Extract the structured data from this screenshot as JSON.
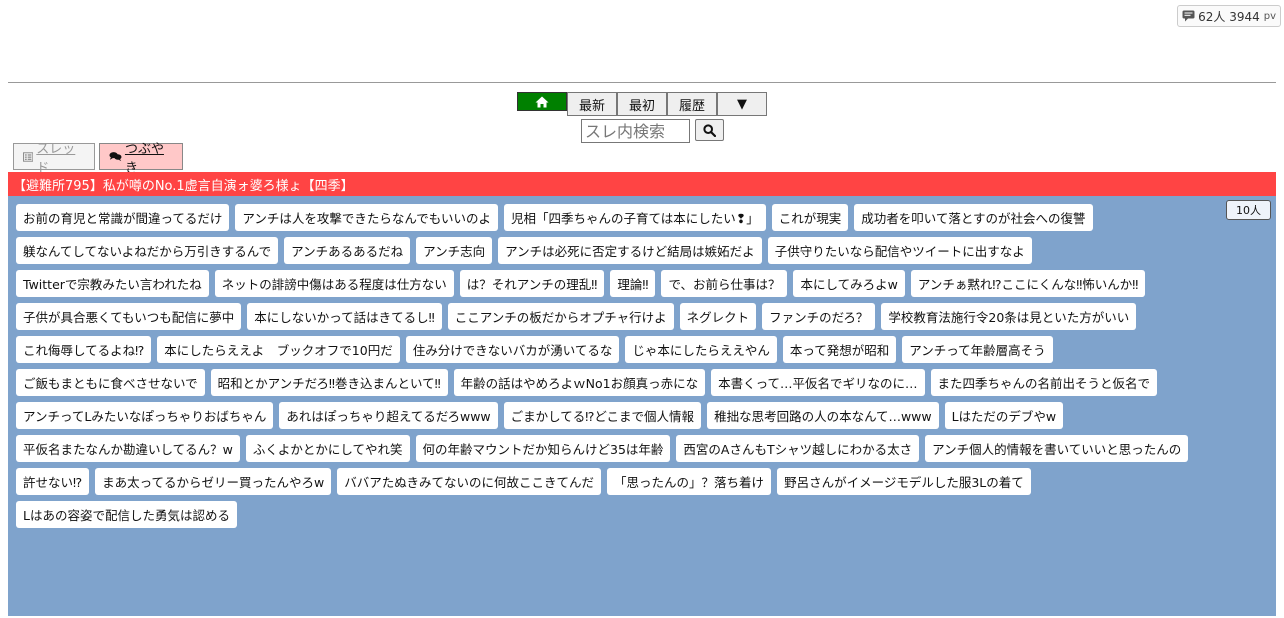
{
  "stats": {
    "text": "62人 3944",
    "pv": "pv"
  },
  "nav": {
    "latest": "最新",
    "first": "最初",
    "history": "履歴",
    "more": "▼"
  },
  "search": {
    "placeholder": "スレ内検索"
  },
  "tabs": {
    "thread": "スレッド",
    "tweet": "つぶやき"
  },
  "title": "【避難所795】私が噂のNo.1虚言自演ォ婆ろ様ょ【四季】",
  "count": "10人",
  "colors": {
    "title_bar": "#ff4444",
    "board": "#7fa3cc",
    "home": "#008000",
    "tweet_tab": "#ffc8c8"
  },
  "chips": [
    "お前の育児と常識が間違ってるだけ",
    "アンチは人を攻撃できたらなんでもいいのよ",
    "児相「四季ちゃんの子育ては本にしたい❢」",
    "これが現実",
    "成功者を叩いて落とすのが社会への復讐",
    "躾なんてしてないよねだから万引きするんで",
    "アンチあるあるだね",
    "アンチ志向",
    "アンチは必死に否定するけど結局は嫉妬だよ",
    "子供守りたいなら配信やツイートに出すなよ",
    "Twitterで宗教みたい言われたね",
    "ネットの誹謗中傷はある程度は仕方ない",
    "は？それアンチの理乱‼",
    "理論‼",
    "で、お前ら仕事は？",
    "本にしてみろよw",
    "アンチぁ黙れ⁉ここにくんな‼怖いんか‼",
    "子供が具合悪くてもいつも配信に夢中",
    "本にしないかって話はきてるし‼",
    "ここアンチの板だからオプチャ行けよ",
    "ネグレクト",
    "ファンチのだろ？",
    "学校教育法施行令20条は見といた方がいい",
    "これ侮辱してるよね⁉",
    "本にしたらええよ　ブックオフで10円だ",
    "住み分けできないバカが湧いてるな",
    "じゃ本にしたらええやん",
    "本って発想が昭和",
    "アンチって年齢層高そう",
    "ご飯もまともに食べさせないで",
    "昭和とかアンチだろ‼巻き込まんといて‼",
    "年齢の話はやめろよｗNo1お顔真っ赤にな",
    "本書くって…平仮名でギリなのに…",
    "また四季ちゃんの名前出そうと仮名で",
    "アンチってLみたいなぽっちゃりおばちゃん",
    "あれはぽっちゃり超えてるだろwww",
    "ごまかしてる⁉どこまで個人情報",
    "稚拙な思考回路の人の本なんて…www",
    "Lはただのデブやw",
    "平仮名またなんか勘違いしてるん？w",
    "ふくよかとかにしてやれ笑",
    "何の年齢マウントだか知らんけど35は年齢",
    "西宮のAさんもTシャツ越しにわかる太さ",
    "アンチ個人的情報を書いていいと思ったんの",
    "許せない⁉",
    "まあ太ってるからゼリー買ったんやろw",
    "ババアたぬきみてないのに何故ここきてんだ",
    "「思ったんの」？落ち着け",
    "野呂さんがイメージモデルした服3Lの着て",
    "Lはあの容姿で配信した勇気は認める"
  ]
}
